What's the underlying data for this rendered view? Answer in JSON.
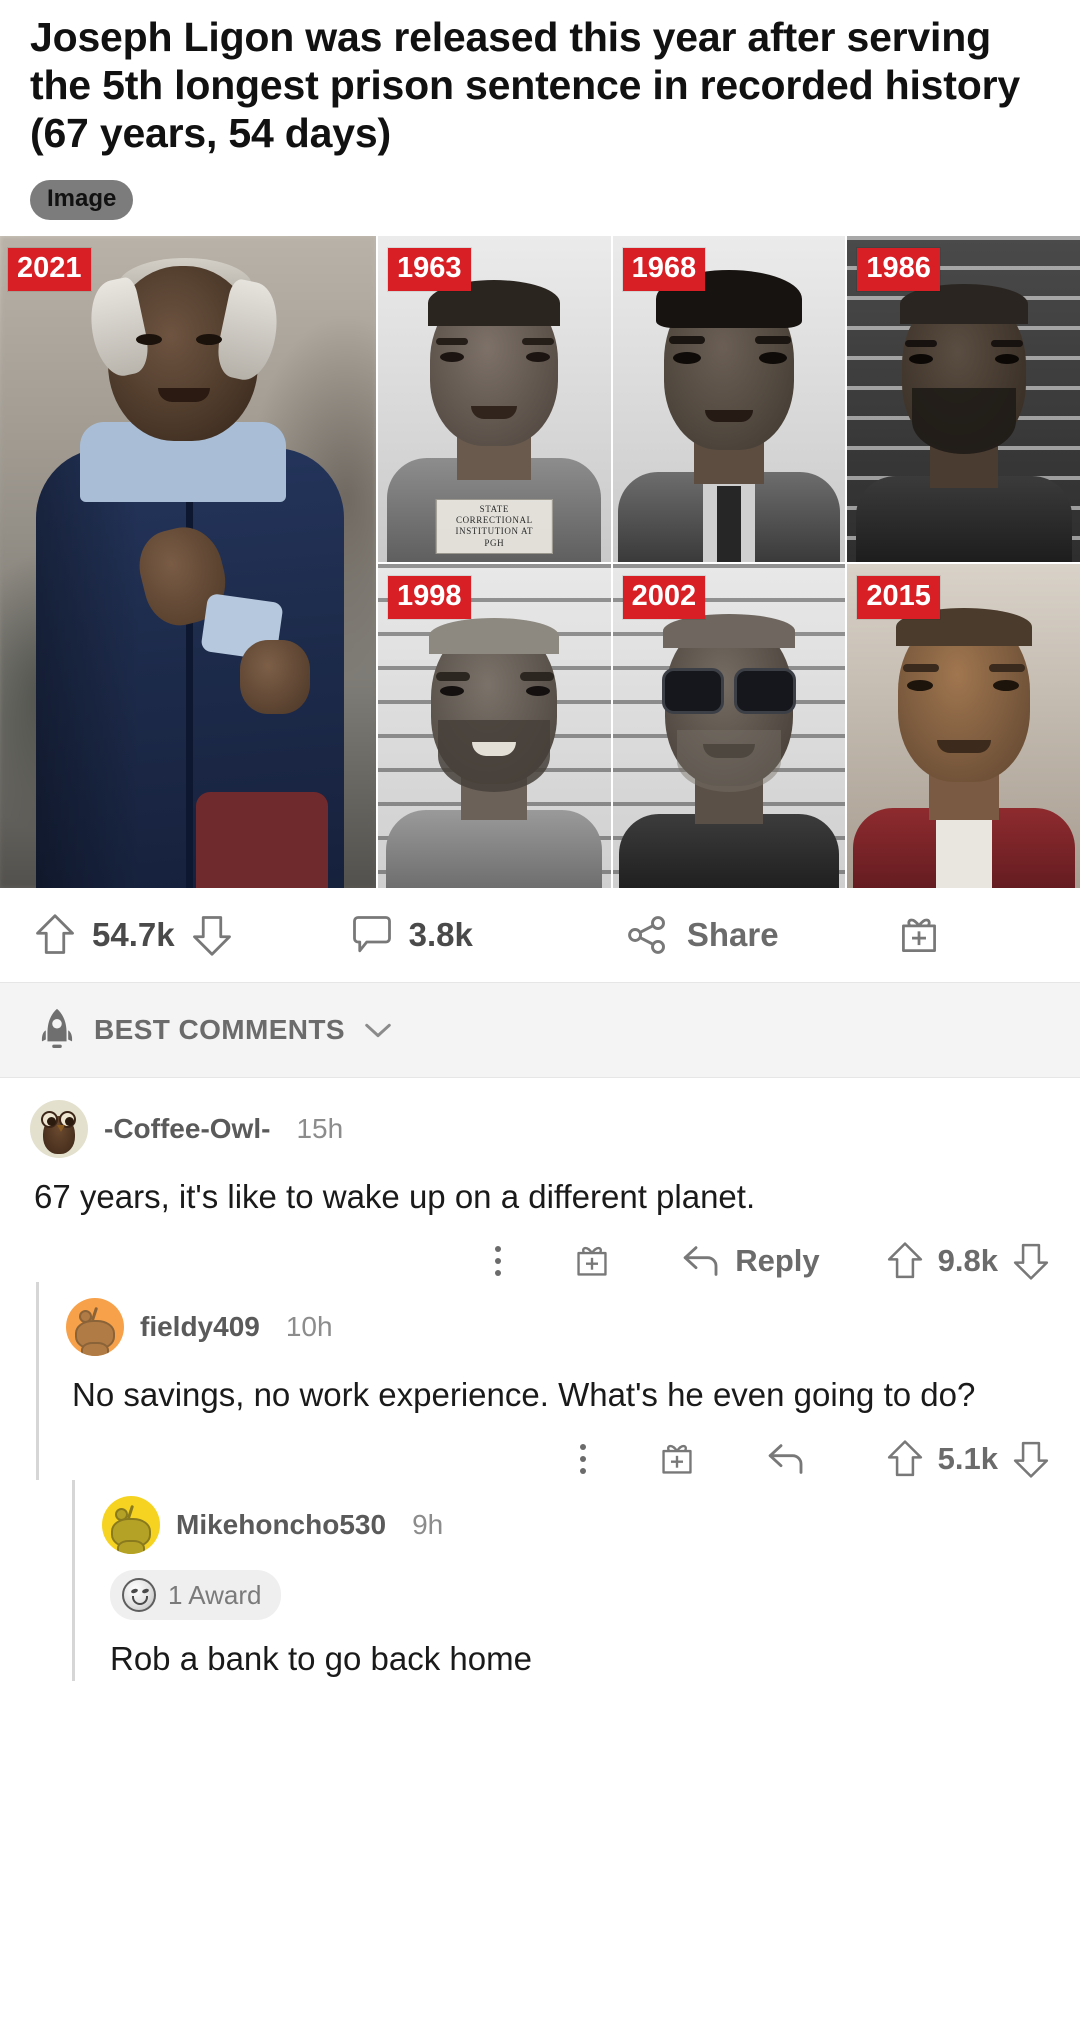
{
  "post": {
    "title": "Joseph Ligon was released this year after serving the 5th longest prison sentence in recorded history (67 years, 54 days)",
    "flair": "Image",
    "image": {
      "alt": "Collage of Joseph Ligon photographs across years",
      "panels": [
        {
          "year": "2021",
          "kind": "color-street-photo"
        },
        {
          "year": "1963",
          "kind": "mugshot-plain"
        },
        {
          "year": "1968",
          "kind": "mugshot-plain"
        },
        {
          "year": "1986",
          "kind": "mugshot-dark"
        },
        {
          "year": "1998",
          "kind": "mugshot-lines"
        },
        {
          "year": "2002",
          "kind": "mugshot-sunglasses"
        },
        {
          "year": "2015",
          "kind": "mugshot-color"
        }
      ],
      "mugshot_plate": "STATE CORRECTIONAL\nINSTITUTION AT PGH"
    },
    "actions": {
      "upvote_icon": "arrow-up-icon",
      "score": "54.7k",
      "downvote_icon": "arrow-down-icon",
      "comment_icon": "comment-bubble-icon",
      "comment_count": "3.8k",
      "share_icon": "share-icon",
      "share_label": "Share",
      "award_icon": "gift-icon"
    }
  },
  "sort": {
    "icon": "rocket-icon",
    "label": "BEST COMMENTS",
    "chevron": "chevron-down-icon"
  },
  "comments": [
    {
      "author": "-Coffee-Owl-",
      "time": "15h",
      "avatar": "owl-avatar",
      "body": "67 years, it's like to wake up on a different planet.",
      "depth": 0,
      "actions": {
        "kebab_icon": "kebab-menu-icon",
        "gift_icon": "gift-icon",
        "reply_icon": "reply-arrow-icon",
        "reply_label": "Reply",
        "upvote_icon": "arrow-up-icon",
        "score": "9.8k",
        "downvote_icon": "arrow-down-icon"
      }
    },
    {
      "author": "fieldy409",
      "time": "10h",
      "avatar": "snoo-orange-avatar",
      "body": "No savings, no work experience. What's he even going to do?",
      "depth": 1,
      "actions": {
        "kebab_icon": "kebab-menu-icon",
        "gift_icon": "gift-icon",
        "reply_icon": "reply-arrow-icon",
        "reply_label": "",
        "upvote_icon": "arrow-up-icon",
        "score": "5.1k",
        "downvote_icon": "arrow-down-icon"
      }
    },
    {
      "author": "Mikehoncho530",
      "time": "9h",
      "avatar": "snoo-yellow-avatar",
      "award": {
        "icon": "award-face-icon",
        "label": "1 Award"
      },
      "body": "Rob a bank to go back home",
      "depth": 2
    }
  ],
  "colors": {
    "year_tag_bg": "#d81f26",
    "flair_bg": "#7c7c7c",
    "sort_bar_bg": "#f4f4f4",
    "text_primary": "#1a1a1a",
    "text_muted": "#6b6b6b",
    "avatar_orange": "#f7a14a",
    "avatar_yellow": "#f5d320",
    "thread_line": "#d6d6d6"
  }
}
